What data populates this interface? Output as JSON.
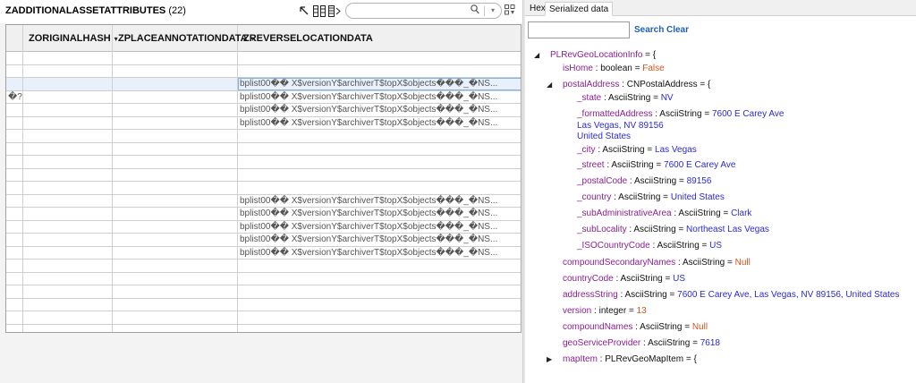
{
  "table_header": {
    "name": "ZADDITIONALASSETATTRIBUTES",
    "count": "(22)"
  },
  "toolbar": {
    "icons": [
      "arrow-up-left-icon",
      "columns-icon",
      "rows-icon"
    ],
    "search_placeholder": ""
  },
  "grid": {
    "columns": [
      {
        "label": "ZORIGINALHASH",
        "caret": "▾"
      },
      {
        "label": "ZPLACEANNOTATIONDATA",
        "caret": "▾"
      },
      {
        "label": "ZREVERSELOCATIONDATA",
        "caret": ""
      }
    ],
    "rows": [
      {
        "c0": "",
        "c1": "",
        "c2": "",
        "c3": ""
      },
      {
        "c0": "",
        "c1": "",
        "c2": "",
        "c3": ""
      },
      {
        "c0": "",
        "c1": "",
        "c2": "",
        "c3": "bplist00�� X$versionY$archiverT$topX$objects���_�NS..."
      },
      {
        "c0": "�?",
        "c1": "",
        "c2": "",
        "c3": "bplist00�� X$versionY$archiverT$topX$objects���_�NS..."
      },
      {
        "c0": "",
        "c1": "",
        "c2": "",
        "c3": "bplist00�� X$versionY$archiverT$topX$objects���_�NS..."
      },
      {
        "c0": "",
        "c1": "",
        "c2": "",
        "c3": "bplist00�� X$versionY$archiverT$topX$objects���_�NS..."
      },
      {
        "c0": "",
        "c1": "",
        "c2": "",
        "c3": ""
      },
      {
        "c0": "",
        "c1": "",
        "c2": "",
        "c3": ""
      },
      {
        "c0": "",
        "c1": "",
        "c2": "",
        "c3": ""
      },
      {
        "c0": "",
        "c1": "",
        "c2": "",
        "c3": ""
      },
      {
        "c0": "",
        "c1": "",
        "c2": "",
        "c3": ""
      },
      {
        "c0": "",
        "c1": "",
        "c2": "",
        "c3": "bplist00�� X$versionY$archiverT$topX$objects���_�NS..."
      },
      {
        "c0": "",
        "c1": "",
        "c2": "",
        "c3": "bplist00�� X$versionY$archiverT$topX$objects���_�NS..."
      },
      {
        "c0": "",
        "c1": "",
        "c2": "",
        "c3": "bplist00�� X$versionY$archiverT$topX$objects���_�NS..."
      },
      {
        "c0": "",
        "c1": "",
        "c2": "",
        "c3": "bplist00�� X$versionY$archiverT$topX$objects���_�NS..."
      },
      {
        "c0": "",
        "c1": "",
        "c2": "",
        "c3": "bplist00�� X$versionY$archiverT$topX$objects���_�NS..."
      },
      {
        "c0": "",
        "c1": "",
        "c2": "",
        "c3": ""
      },
      {
        "c0": "",
        "c1": "",
        "c2": "",
        "c3": ""
      },
      {
        "c0": "",
        "c1": "",
        "c2": "",
        "c3": ""
      },
      {
        "c0": "",
        "c1": "",
        "c2": "",
        "c3": ""
      },
      {
        "c0": "",
        "c1": "",
        "c2": "",
        "c3": ""
      },
      {
        "c0": "",
        "c1": "",
        "c2": "",
        "c3": ""
      }
    ]
  },
  "right_tabs": {
    "hex": "Hex",
    "serialized": "Serialized data"
  },
  "serialized": {
    "search_value": "",
    "search_label": "Search",
    "clear_label": "Clear",
    "tree": [
      {
        "toggle": "◢",
        "key": "PLRevGeoLocationInfo",
        "sep": " = {"
      },
      {
        "key": "isHome",
        "sep": " : ",
        "type": "boolean",
        "eq": " = ",
        "value": "False",
        "vclass": "vo"
      },
      {
        "toggle": "◢",
        "key": "postalAddress",
        "sep": " : ",
        "type": "CNPostalAddress",
        "eq": " = {"
      },
      {
        "key": "_state",
        "sep": " : ",
        "type": "AsciiString",
        "eq": " = ",
        "value": "NV",
        "vclass": "vs"
      },
      {
        "key": "_formattedAddress",
        "sep": " : ",
        "type": "AsciiString",
        "eq": " = ",
        "value": "7600 E Carey Ave",
        "vclass": "vs"
      },
      {
        "value": "Las Vegas, NV  89156",
        "vclass": "vs"
      },
      {
        "value": "United States",
        "vclass": "vs"
      },
      {
        "key": "_city",
        "sep": " : ",
        "type": "AsciiString",
        "eq": " = ",
        "value": "Las Vegas",
        "vclass": "vs"
      },
      {
        "key": "_street",
        "sep": " : ",
        "type": "AsciiString",
        "eq": " = ",
        "value": "7600 E Carey Ave",
        "vclass": "vs"
      },
      {
        "key": "_postalCode",
        "sep": " : ",
        "type": "AsciiString",
        "eq": " = ",
        "value": "89156",
        "vclass": "vs"
      },
      {
        "key": "_country",
        "sep": " : ",
        "type": "AsciiString",
        "eq": " = ",
        "value": "United States",
        "vclass": "vs"
      },
      {
        "key": "_subAdministrativeArea",
        "sep": " : ",
        "type": "AsciiString",
        "eq": " = ",
        "value": "Clark",
        "vclass": "vs"
      },
      {
        "key": "_subLocality",
        "sep": " : ",
        "type": "AsciiString",
        "eq": " = ",
        "value": "Northeast Las Vegas",
        "vclass": "vs"
      },
      {
        "key": "_ISOCountryCode",
        "sep": " : ",
        "type": "AsciiString",
        "eq": " = ",
        "value": "US",
        "vclass": "vs"
      },
      {
        "key": "compoundSecondaryNames",
        "sep": " : ",
        "type": "AsciiString",
        "eq": " = ",
        "value": "Null",
        "vclass": "vo"
      },
      {
        "key": "countryCode",
        "sep": " : ",
        "type": "AsciiString",
        "eq": " = ",
        "value": "US",
        "vclass": "vs"
      },
      {
        "key": "addressString",
        "sep": " : ",
        "type": "AsciiString",
        "eq": " = ",
        "value": "7600 E Carey Ave, Las Vegas, NV  89156, United States",
        "vclass": "vs"
      },
      {
        "key": "version",
        "sep": " : ",
        "type": "integer",
        "eq": " = ",
        "value": "13",
        "vclass": "vo"
      },
      {
        "key": "compoundNames",
        "sep": " : ",
        "type": "AsciiString",
        "eq": " = ",
        "value": "Null",
        "vclass": "vo"
      },
      {
        "key": "geoServiceProvider",
        "sep": " : ",
        "type": "AsciiString",
        "eq": " = ",
        "value": "7618",
        "vclass": "vs"
      },
      {
        "toggle": "▶",
        "key": "mapItem",
        "sep": " : ",
        "type": "PLRevGeoMapItem",
        "eq": " = {"
      }
    ]
  }
}
